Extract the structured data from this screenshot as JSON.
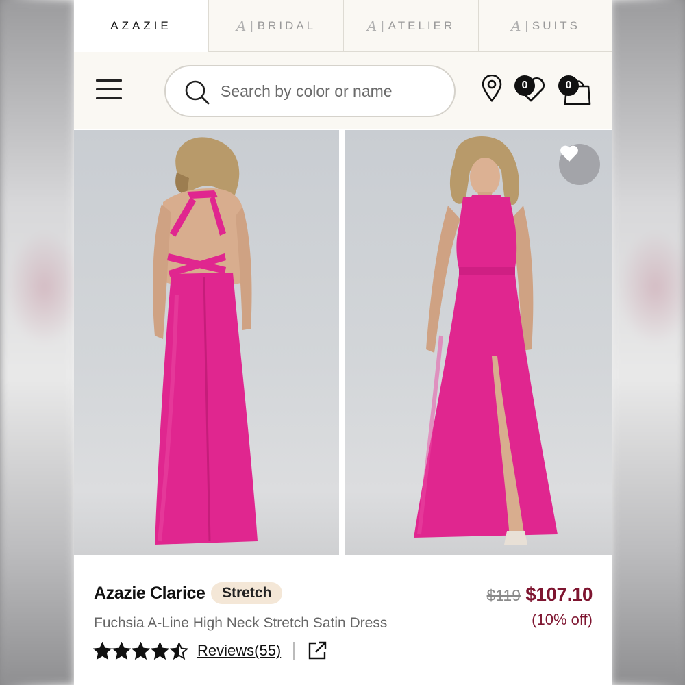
{
  "brand_tabs": [
    {
      "label": "AZAZIE",
      "active": true
    },
    {
      "label": "BRIDAL",
      "active": false
    },
    {
      "label": "ATELIER",
      "active": false
    },
    {
      "label": "SUITS",
      "active": false
    }
  ],
  "header": {
    "search_placeholder": "Search by color or name",
    "wishlist_count": "0",
    "cart_count": "0"
  },
  "product": {
    "name": "Azazie Clarice",
    "tag": "Stretch",
    "subtitle": "Fuchsia A-Line High Neck Stretch Satin Dress",
    "original_price": "$119",
    "sale_price": "$107.10",
    "discount": "(10% off)",
    "rating": 4.5,
    "reviews_label": "Reviews(55)",
    "dress_color": "#e0268f",
    "price_color": "#7e1530"
  }
}
